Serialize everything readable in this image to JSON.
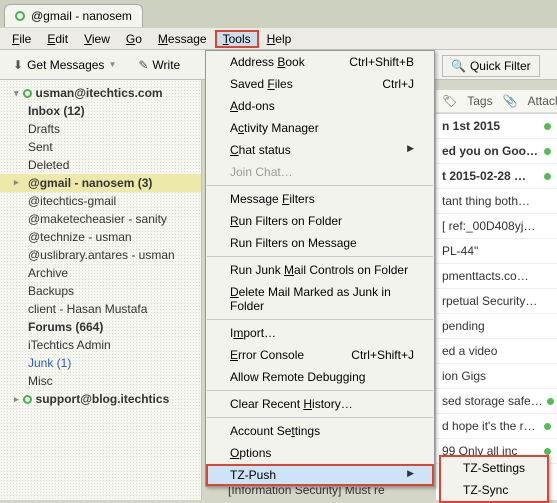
{
  "tab": {
    "title": "@gmail - nanosem"
  },
  "menu": {
    "file": "File",
    "edit": "Edit",
    "view": "View",
    "go": "Go",
    "message": "Message",
    "tools": "Tools",
    "help": "Help"
  },
  "toolbar": {
    "get_messages": "Get Messages",
    "write": "Write",
    "quick_filter": "Quick Filter",
    "tags": "Tags",
    "attachment": "Attachmen"
  },
  "sidebar": {
    "account": "usman@itechtics.com",
    "items": [
      {
        "label": "Inbox (12)",
        "bold": true
      },
      {
        "label": "Drafts"
      },
      {
        "label": "Sent"
      },
      {
        "label": "Deleted"
      },
      {
        "label": "@gmail - nanosem (3)",
        "bold": true,
        "highlight": true
      },
      {
        "label": "@itechtics-gmail"
      },
      {
        "label": "@maketecheasier - sanity"
      },
      {
        "label": "@technize - usman"
      },
      {
        "label": "@uslibrary.antares - usman"
      },
      {
        "label": "Archive"
      },
      {
        "label": "Backups"
      },
      {
        "label": "client - Hasan Mustafa"
      },
      {
        "label": "Forums (664)",
        "bold": true
      },
      {
        "label": "iTechtics Admin"
      },
      {
        "label": "Junk (1)",
        "blue": true
      },
      {
        "label": "Misc"
      }
    ],
    "account2": "support@blog.itechtics"
  },
  "tools_menu": [
    {
      "label": "Address Book",
      "accel": "Ctrl+Shift+B",
      "u": 8
    },
    {
      "label": "Saved Files",
      "accel": "Ctrl+J",
      "u": 6
    },
    {
      "label": "Add-ons",
      "u": 0
    },
    {
      "label": "Activity Manager",
      "u": 1
    },
    {
      "label": "Chat status",
      "submenu": true,
      "u": 0
    },
    {
      "label": "Join Chat…",
      "disabled": true
    },
    {
      "sep": true
    },
    {
      "label": "Message Filters",
      "u": 8
    },
    {
      "label": "Run Filters on Folder",
      "u": 0
    },
    {
      "label": "Run Filters on Message"
    },
    {
      "sep": true
    },
    {
      "label": "Run Junk Mail Controls on Folder",
      "u": 9
    },
    {
      "label": "Delete Mail Marked as Junk in Folder",
      "u": 0
    },
    {
      "sep": true
    },
    {
      "label": "Import…",
      "u": 1
    },
    {
      "label": "Error Console",
      "accel": "Ctrl+Shift+J",
      "u": 0
    },
    {
      "label": "Allow Remote Debugging"
    },
    {
      "sep": true
    },
    {
      "label": "Clear Recent History…",
      "u": 13
    },
    {
      "sep": true
    },
    {
      "label": "Account Settings",
      "u": 10
    },
    {
      "label": "Options",
      "u": 0
    },
    {
      "label": "TZ-Push",
      "submenu": true,
      "hover": true
    }
  ],
  "submenu": [
    {
      "label": "TZ-Settings"
    },
    {
      "label": "TZ-Sync"
    }
  ],
  "messages": [
    {
      "subject": "n 1st 2015",
      "bold": true,
      "dot": true
    },
    {
      "subject": "ed you on Goo…",
      "bold": true,
      "dot": true
    },
    {
      "subject": "t 2015-02-28 …",
      "bold": true,
      "dot": true
    },
    {
      "subject": "tant thing both…"
    },
    {
      "subject": "[ ref:_00D408yj…"
    },
    {
      "subject": "PL-44\""
    },
    {
      "subject": "pmenttacts.co…"
    },
    {
      "subject": "rpetual Security…"
    },
    {
      "subject": "pending"
    },
    {
      "subject": "ed a video"
    },
    {
      "subject": "ion Gigs"
    },
    {
      "subject": "sed storage safe…",
      "dot": true
    },
    {
      "subject": "d hope it's the r…",
      "dot": true
    },
    {
      "subject": "99 Only all inc",
      "dot": true
    }
  ],
  "info_sec": "[Information Security]  Must re"
}
